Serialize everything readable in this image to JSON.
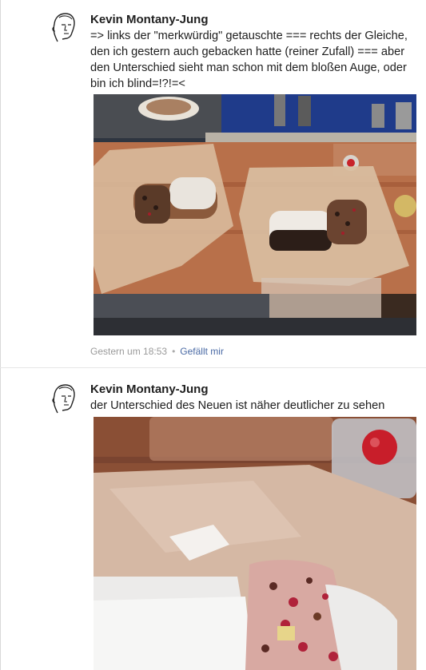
{
  "feed": {
    "posts": [
      {
        "author": "Kevin Montany-Jung",
        "text": "=> links der \"merkwürdig\" getauschte === rechts der Gleiche, den ich gestern auch gebacken hatte (reiner Zufall) === aber den Unterschied sieht man schon mit dem bloßen Auge, oder bin ich blind=!?!=<",
        "timestamp": "Gestern um 18:53",
        "separator": "•",
        "like_label": "Gefällt mir"
      },
      {
        "author": "Kevin Montany-Jung",
        "text": "der Unterschied des Neuen ist näher  deutlicher zu sehen"
      }
    ]
  },
  "colors": {
    "like_link": "#4a6aa5",
    "meta_text": "#9a9a9a",
    "author_text": "#1f1f1f"
  },
  "icons": [
    "avatar-sketch-face"
  ]
}
